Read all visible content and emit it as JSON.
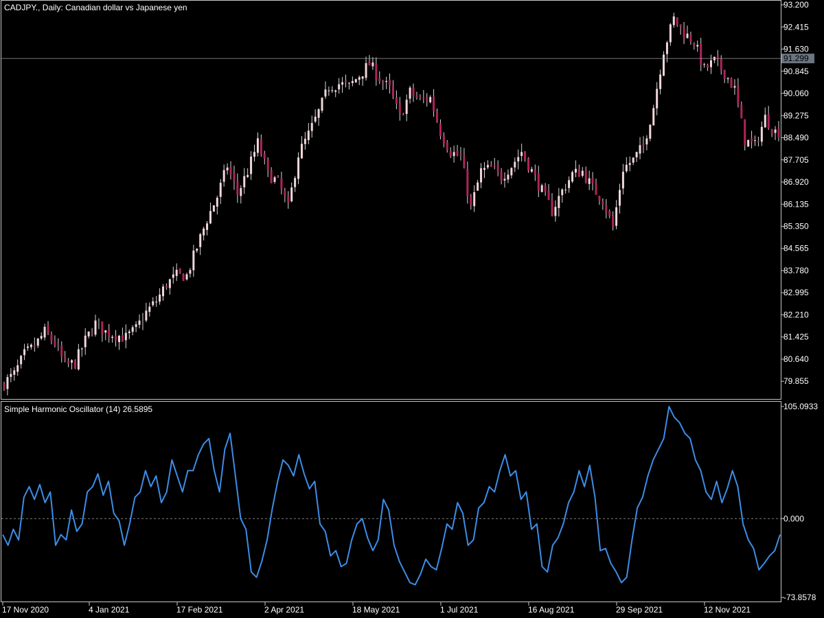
{
  "colors": {
    "background": "#000000",
    "frame": "#c8c8c8",
    "bull_candle": "#f2d6da",
    "bear_candle": "#b0245a",
    "wick": "#d9d9d9",
    "oscillator": "#3d8ee8",
    "zero_line": "#808080",
    "current_price_bg": "#6a7580"
  },
  "header": {
    "symbol_title": "CADJPY., Daily:  Canadian dollar vs Japanese yen"
  },
  "price_axis": {
    "labels": [
      "93.200",
      "92.415",
      "91.630",
      "90.845",
      "90.060",
      "89.275",
      "88.490",
      "87.705",
      "86.920",
      "86.135",
      "85.350",
      "84.565",
      "83.780",
      "82.995",
      "82.210",
      "81.425",
      "80.640",
      "79.855"
    ],
    "current_price": "91.299"
  },
  "oscillator_panel": {
    "title": "Simple Harmonic Oscillator (14) 26.5895",
    "max_label": "105.0933",
    "zero_label": "0.000",
    "min_label": "-73.8578"
  },
  "time_axis": {
    "labels": [
      "17 Nov 2020",
      "4 Jan 2021",
      "17 Feb 2021",
      "2 Apr 2021",
      "18 May 2021",
      "1 Jul 2021",
      "16 Aug 2021",
      "29 Sep 2021",
      "12 Nov 2021"
    ]
  },
  "chart_data": [
    {
      "type": "candlestick",
      "title": "CADJPY., Daily:  Canadian dollar vs Japanese yen",
      "ylim": [
        79.3,
        93.25
      ],
      "current_price": 91.299,
      "close_path": [
        [
          0,
          79.8
        ],
        [
          3,
          80.1
        ],
        [
          6,
          80.8
        ],
        [
          9,
          81.1
        ],
        [
          12,
          81.6
        ],
        [
          15,
          81.2
        ],
        [
          18,
          80.4
        ],
        [
          21,
          80.5
        ],
        [
          24,
          81.3
        ],
        [
          27,
          81.9
        ],
        [
          30,
          81.6
        ],
        [
          33,
          81.5
        ],
        [
          36,
          81.4
        ],
        [
          39,
          81.7
        ],
        [
          42,
          82.3
        ],
        [
          45,
          82.7
        ],
        [
          48,
          83.3
        ],
        [
          51,
          83.6
        ],
        [
          54,
          83.6
        ],
        [
          57,
          84.6
        ],
        [
          60,
          85.6
        ],
        [
          63,
          86.4
        ],
        [
          66,
          87.5
        ],
        [
          69,
          86.5
        ],
        [
          72,
          87.3
        ],
        [
          75,
          88.3
        ],
        [
          78,
          87.2
        ],
        [
          81,
          86.9
        ],
        [
          84,
          86.0
        ],
        [
          87,
          87.9
        ],
        [
          90,
          88.6
        ],
        [
          93,
          89.4
        ],
        [
          96,
          90.3
        ],
        [
          99,
          90.4
        ],
        [
          102,
          90.3
        ],
        [
          105,
          90.7
        ],
        [
          108,
          91.1
        ],
        [
          111,
          90.6
        ],
        [
          114,
          90.2
        ],
        [
          117,
          89.2
        ],
        [
          120,
          90.1
        ],
        [
          123,
          89.8
        ],
        [
          126,
          89.9
        ],
        [
          129,
          88.7
        ],
        [
          132,
          88.0
        ],
        [
          135,
          87.8
        ],
        [
          138,
          86.0
        ],
        [
          141,
          87.3
        ],
        [
          144,
          87.4
        ],
        [
          147,
          87.1
        ],
        [
          150,
          87.5
        ],
        [
          153,
          88.0
        ],
        [
          156,
          87.3
        ],
        [
          159,
          86.6
        ],
        [
          162,
          85.9
        ],
        [
          165,
          86.6
        ],
        [
          168,
          87.2
        ],
        [
          171,
          87.3
        ],
        [
          174,
          86.7
        ],
        [
          177,
          86.3
        ],
        [
          180,
          85.3
        ],
        [
          183,
          87.4
        ],
        [
          186,
          87.7
        ],
        [
          189,
          88.2
        ],
        [
          192,
          89.6
        ],
        [
          195,
          91.6
        ],
        [
          198,
          92.7
        ],
        [
          201,
          92.2
        ],
        [
          204,
          91.9
        ],
        [
          207,
          90.9
        ],
        [
          210,
          91.2
        ],
        [
          213,
          90.8
        ],
        [
          216,
          90.2
        ],
        [
          219,
          88.4
        ],
        [
          222,
          88.2
        ],
        [
          225,
          89.2
        ],
        [
          228,
          88.7
        ]
      ]
    },
    {
      "type": "line",
      "title": "Simple Harmonic Oscillator (14) 26.5895",
      "ylim": [
        -73.8578,
        105.0933
      ],
      "values": [
        -15,
        -25,
        -10,
        -20,
        20,
        30,
        18,
        32,
        15,
        25,
        -25,
        -15,
        -20,
        8,
        -12,
        -5,
        25,
        30,
        42,
        22,
        35,
        5,
        -2,
        -25,
        -5,
        20,
        25,
        45,
        30,
        40,
        15,
        25,
        55,
        40,
        25,
        45,
        45,
        60,
        70,
        75,
        45,
        25,
        65,
        80,
        40,
        0,
        -10,
        -50,
        -55,
        -40,
        -20,
        10,
        35,
        55,
        50,
        40,
        60,
        42,
        28,
        35,
        -5,
        -12,
        -35,
        -30,
        -45,
        -42,
        -20,
        -5,
        0,
        -18,
        -30,
        -20,
        18,
        8,
        -25,
        -40,
        -50,
        -60,
        -62,
        -52,
        -38,
        -45,
        -48,
        -28,
        -5,
        -10,
        15,
        5,
        -25,
        -20,
        10,
        15,
        30,
        25,
        45,
        60,
        40,
        45,
        18,
        25,
        -10,
        -5,
        -45,
        -50,
        -25,
        -18,
        -5,
        15,
        25,
        45,
        30,
        50,
        20,
        -30,
        -28,
        -42,
        -50,
        -60,
        -55,
        -20,
        10,
        20,
        40,
        55,
        65,
        75,
        105,
        95,
        90,
        80,
        75,
        55,
        45,
        25,
        18,
        35,
        15,
        28,
        45,
        30,
        -5,
        -20,
        -28,
        -48,
        -42,
        -35,
        -30,
        -15
      ]
    }
  ]
}
